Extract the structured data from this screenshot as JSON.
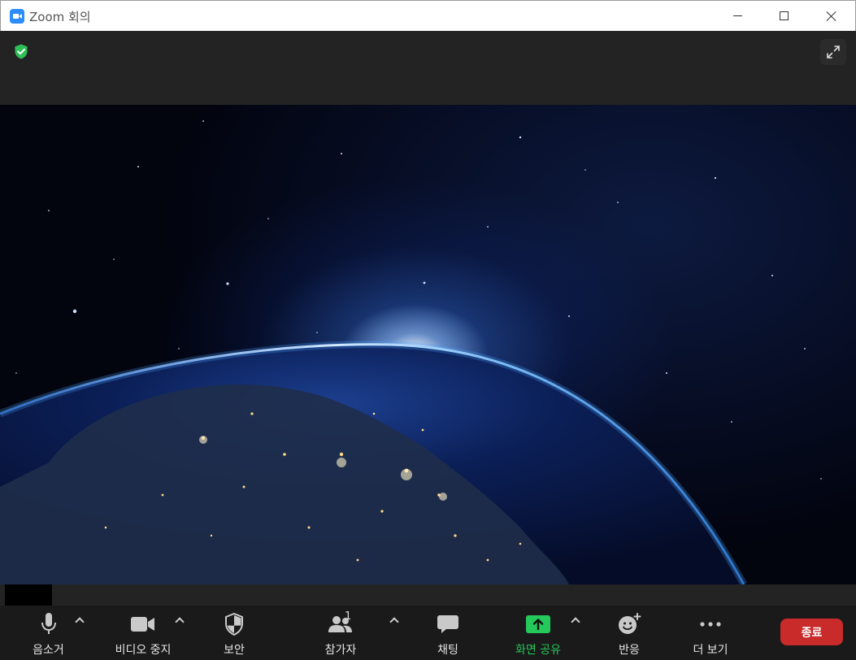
{
  "window": {
    "title": "Zoom 회의"
  },
  "colors": {
    "security_green": "#2fbf57",
    "share_green": "#25c85b",
    "end_red": "#c92a2a"
  },
  "toolbar": {
    "mute_label": "음소거",
    "video_label": "비디오 중지",
    "security_label": "보안",
    "participants_label": "참가자",
    "participants_count": "1",
    "chat_label": "채팅",
    "share_label": "화면 공유",
    "reactions_label": "반응",
    "more_label": "더 보기",
    "end_label": "종료"
  },
  "icons": {
    "security_status": "shield-check-icon",
    "fullscreen": "expand-icon",
    "mute": "microphone-icon",
    "video": "video-camera-icon",
    "security": "shield-icon",
    "participants": "people-icon",
    "chat": "chat-bubble-icon",
    "share": "share-up-arrow-icon",
    "reactions": "smiley-plus-icon",
    "more": "ellipsis-icon"
  }
}
